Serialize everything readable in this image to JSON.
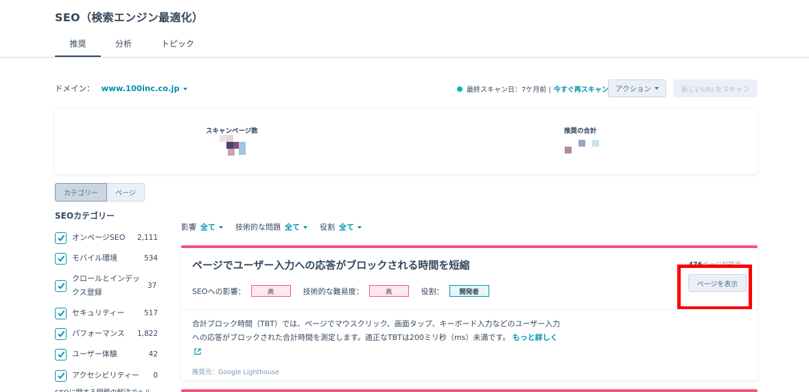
{
  "page": {
    "title": "SEO（検索エンジン最適化）"
  },
  "tabs": [
    {
      "label": "推奨",
      "active": true
    },
    {
      "label": "分析",
      "active": false
    },
    {
      "label": "トピック",
      "active": false
    }
  ],
  "domain": {
    "label": "ドメイン：",
    "value": "www.100inc.co.jp"
  },
  "scan": {
    "status_text": "最終スキャン日：7ケ月前 |",
    "rescan_label": "今すぐ再スキャン",
    "status_color": "#00bda5"
  },
  "toolbar": {
    "action_label": "アクション",
    "scan_url_label": "新しいURLをスキャン"
  },
  "stats": {
    "scanned_pages_label": "スキャンページ数",
    "recommendations_label": "推奨の合計"
  },
  "view_toggle": {
    "category_label": "カテゴリー",
    "page_label": "ページ",
    "selected": "カテゴリー"
  },
  "sidebar": {
    "title": "SEOカテゴリー",
    "items": [
      {
        "label": "オンページSEO",
        "count": "2,111",
        "checked": true
      },
      {
        "label": "モバイル環境",
        "count": "534",
        "checked": true
      },
      {
        "label": "クロールとインデックス登録",
        "count": "37",
        "checked": true
      },
      {
        "label": "セキュリティー",
        "count": "517",
        "checked": true
      },
      {
        "label": "パフォーマンス",
        "count": "1,822",
        "checked": true
      },
      {
        "label": "ユーザー体験",
        "count": "42",
        "checked": true
      },
      {
        "label": "アクセシビリティー",
        "count": "0",
        "checked": true
      }
    ],
    "footer_text": "SEOに関する問題の解決でヘル"
  },
  "filters": [
    {
      "label": "影響",
      "value": "全て"
    },
    {
      "label": "技術的な問題",
      "value": "全て"
    },
    {
      "label": "役割",
      "value": "全て"
    }
  ],
  "recommendation": {
    "title": "ページでユーザー入力への応答がブロックされる時間を短縮",
    "pages_count": "476",
    "pages_suffix": "ページが該当",
    "impact_label": "SEOへの影響：",
    "impact_value": "高",
    "difficulty_label": "技術的な難易度：",
    "difficulty_value": "高",
    "role_label": "役割：",
    "role_value": "開発者",
    "view_button": "ページを表示",
    "description": "合計ブロック時間（TBT）では、ページでマウスクリック、画面タップ、キーボード入力などのユーザー入力への応答がブロックされた合計時間を測定します。適正なTBTは200ミリ秒（ms）未満です。",
    "more_link": "もっと詳しく",
    "source": "推奨元：Google Lighthouse",
    "accent_color": "#f2547d"
  }
}
